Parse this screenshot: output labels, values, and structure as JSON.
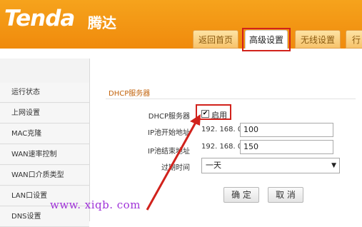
{
  "brand": {
    "logo": "Tenda",
    "name_cn": "腾达"
  },
  "tabs": [
    {
      "label": "返回首页",
      "active": false
    },
    {
      "label": "高级设置",
      "active": true
    },
    {
      "label": "无线设置",
      "active": false
    },
    {
      "label": "行",
      "active": false
    }
  ],
  "sidebar": {
    "items": [
      {
        "label": "运行状态"
      },
      {
        "label": "上网设置"
      },
      {
        "label": "MAC克隆"
      },
      {
        "label": "WAN速率控制"
      },
      {
        "label": "WAN口介质类型"
      },
      {
        "label": "LAN口设置"
      },
      {
        "label": "DNS设置"
      }
    ]
  },
  "dhcp": {
    "section_title": "DHCP服务器",
    "server_label": "DHCP服务器",
    "enable_label": "启用",
    "enabled": true,
    "start_label": "IP池开始地址",
    "start_prefix": "192. 168. 0.",
    "start_value": "100",
    "end_label": "IP池结束地址",
    "end_prefix": "192. 168. 0.",
    "end_value": "150",
    "lease_label": "过期时间",
    "lease_value": "一天"
  },
  "buttons": {
    "ok": "确 定",
    "cancel": "取 消"
  },
  "watermark": "www. xiqb. com",
  "colors": {
    "header": "#f39a17",
    "highlight": "#d1221c",
    "watermark": "#9f32d8"
  }
}
